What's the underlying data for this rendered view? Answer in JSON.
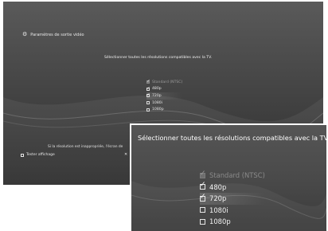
{
  "screen": {
    "header_title": "Paramètres de sortie vidéo",
    "header_icon": "display-settings-icon",
    "instruction": "Sélectionner toutes les résolutions compatibles avec la TV.",
    "note": "Si la résolution est inappropriée, l'écran de",
    "test_label": "Tester affichage",
    "close_glyph": "✕",
    "items": [
      {
        "label": "Standard (NTSC)",
        "checked": true,
        "disabled": true
      },
      {
        "label": "480p",
        "checked": true,
        "disabled": false
      },
      {
        "label": "720p",
        "checked": true,
        "disabled": false
      },
      {
        "label": "1080i",
        "checked": false,
        "disabled": false
      },
      {
        "label": "1080p",
        "checked": false,
        "disabled": false
      }
    ]
  },
  "inset": {
    "instruction": "Sélectionner toutes les résolutions compatibles avec la TV.",
    "items": [
      {
        "label": "Standard (NTSC)",
        "checked": true,
        "disabled": true
      },
      {
        "label": "480p",
        "checked": true,
        "disabled": false
      },
      {
        "label": "720p",
        "checked": true,
        "disabled": false
      },
      {
        "label": "1080i",
        "checked": false,
        "disabled": false
      },
      {
        "label": "1080p",
        "checked": false,
        "disabled": false
      }
    ]
  }
}
